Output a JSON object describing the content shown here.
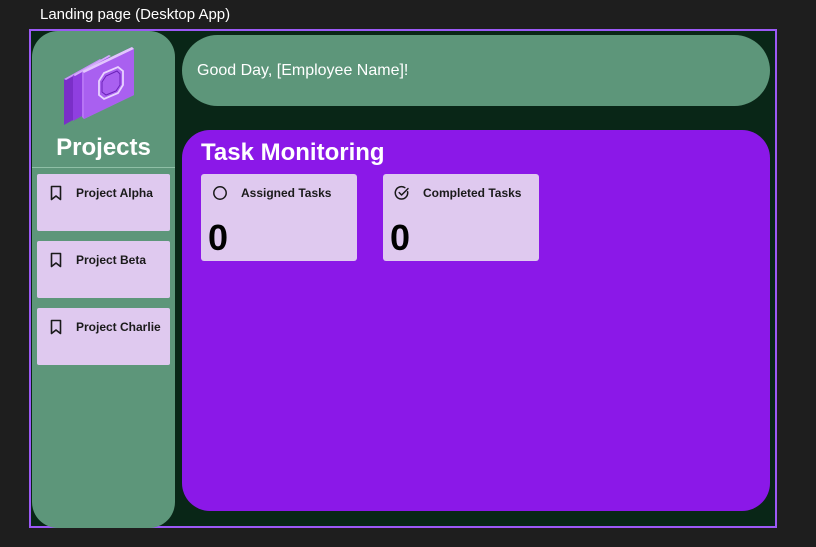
{
  "frame": {
    "title": "Landing page (Desktop App)"
  },
  "sidebar": {
    "title": "Projects",
    "logo_icon": "stacked-documents-icon",
    "items": [
      {
        "label": "Project Alpha",
        "icon": "bookmark-icon"
      },
      {
        "label": "Project Beta",
        "icon": "bookmark-icon"
      },
      {
        "label": "Project Charlie",
        "icon": "bookmark-icon"
      }
    ]
  },
  "header": {
    "greeting": "Good Day, [Employee Name]!"
  },
  "task_monitoring": {
    "title": "Task Monitoring",
    "cards": [
      {
        "label": "Assigned Tasks",
        "value": "0",
        "icon": "circle-icon"
      },
      {
        "label": "Completed Tasks",
        "value": "0",
        "icon": "check-circle-icon"
      }
    ]
  },
  "colors": {
    "background": "#1e1e1e",
    "frame_bg": "#092617",
    "frame_border": "#9b59f5",
    "panel_green": "#5d967a",
    "accent_purple": "#8b18e8",
    "card_lavender": "#dfc9ef",
    "logo_purple": "#b070f0"
  }
}
